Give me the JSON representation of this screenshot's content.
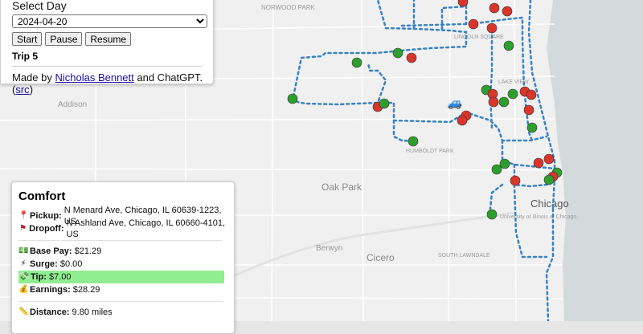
{
  "controls": {
    "select_label": "Select Day",
    "selected_day": "2024-04-20",
    "start_label": "Start",
    "pause_label": "Pause",
    "resume_label": "Resume",
    "trip_label": "Trip 5",
    "credit_prefix": "Made by ",
    "credit_author": "Nicholas Bennett",
    "credit_middle": " and ChatGPT. (",
    "credit_src": "src",
    "credit_suffix": ")"
  },
  "map": {
    "labels": [
      "NORWOOD PARK",
      "LINCOLN SQUARE",
      "LAKE VIEW",
      "Addison",
      "HUMBOLDT PARK",
      "Oak Park",
      "Chicago",
      "University of Illinois at Chicago",
      "Berwyn",
      "Cicero",
      "SOUTH LAWNDALE"
    ],
    "car_icon": "car-icon",
    "colors": {
      "route": "#3b82c4",
      "pickup_marker": "#2e9e2e",
      "dropoff_marker": "#d9352b",
      "water": "#d4dadc",
      "land": "#f0f0f0"
    }
  },
  "info": {
    "ride_type": "Comfort",
    "pickup_label": "Pickup:",
    "pickup_value": "N Menard Ave, Chicago, IL 60639-1223, US",
    "dropoff_label": "Dropoff:",
    "dropoff_value": "N Ashland Ave, Chicago, IL 60660-4101, US",
    "base_label": "Base Pay:",
    "base_value": "$21.29",
    "surge_label": "Surge:",
    "surge_value": "$0.00",
    "tip_label": "Tip:",
    "tip_value": "$7.00",
    "earn_label": "Earnings:",
    "earn_value": "$28.29",
    "dist_label": "Distance:",
    "dist_value": "9.80 miles"
  }
}
